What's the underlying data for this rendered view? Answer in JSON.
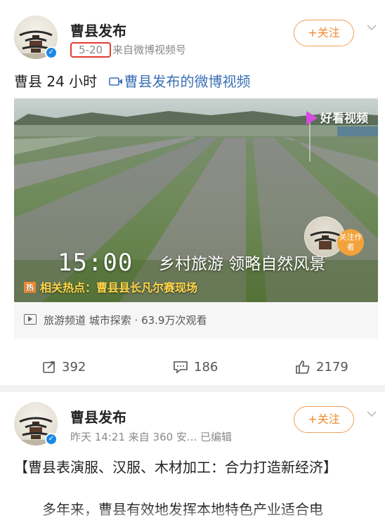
{
  "posts": [
    {
      "account_name": "曹县发布",
      "date": "5-20",
      "source": "来自微博视频号",
      "follow_label": "+关注",
      "text": "曹县 24 小时",
      "video_link": "曹县发布的微博视频",
      "video": {
        "watermark": "好看视频",
        "time_overlay": "15:00",
        "caption_overlay": "乡村旅游  领略自然风景",
        "hot_tag": "热",
        "hot_text": "相关热点：曹县县长凡尔赛现场",
        "follow_author": "关注作者"
      },
      "channel_info": "旅游频道 城市探索 · 63.9万次观看",
      "actions": {
        "share": "392",
        "comment": "186",
        "like": "2179"
      }
    },
    {
      "account_name": "曹县发布",
      "meta": "昨天 14:21  来自 360 安...  已编辑",
      "follow_label": "+关注",
      "title": "【曹县表演服、汉服、木材加工：合力打造新经济】",
      "paragraph": "多年来，曹县有效地发挥本地特色产业适合电"
    }
  ],
  "colors": {
    "follow_orange": "#f28a2e",
    "link_blue": "#3b6fb5",
    "highlight_red": "#e23b2e",
    "verified_blue": "#1e88e5"
  },
  "icons": [
    "chevron-down-icon",
    "verified-icon",
    "video-link-icon",
    "play-channel-icon",
    "share-icon",
    "comment-icon",
    "like-icon"
  ]
}
